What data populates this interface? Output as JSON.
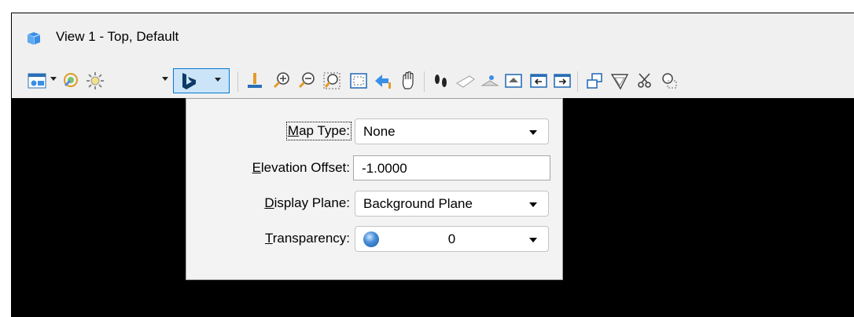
{
  "window": {
    "title": "View 1 - Top, Default"
  },
  "toolbar": {
    "buttons": [
      "view-attributes-icon",
      "display-style-icon",
      "lights-icon",
      "bing-maps-icon",
      "place-ruler-icon",
      "zoom-in-icon",
      "zoom-out-icon",
      "window-area-icon",
      "fit-view-icon",
      "rotate-view-icon",
      "pan-view-icon",
      "walk-icon",
      "view-previous-icon",
      "view-next-icon",
      "copy-view-icon",
      "clip-volume-icon",
      "clip-mask-icon",
      "camera-icon"
    ]
  },
  "panel": {
    "map_type": {
      "label_pre": "",
      "label_key": "M",
      "label_post": "ap Type:",
      "value": "None"
    },
    "elevation_offset": {
      "label_key": "E",
      "label_post": "levation Offset:",
      "value": "-1.0000"
    },
    "display_plane": {
      "label_key": "D",
      "label_post": "isplay Plane:",
      "value": "Background Plane"
    },
    "transparency": {
      "label_key": "T",
      "label_post": "ransparency:",
      "value": "0"
    }
  },
  "colors": {
    "accent": "#0078d4",
    "viewport": "#000000",
    "active_button_bg": "#cce4f7"
  }
}
